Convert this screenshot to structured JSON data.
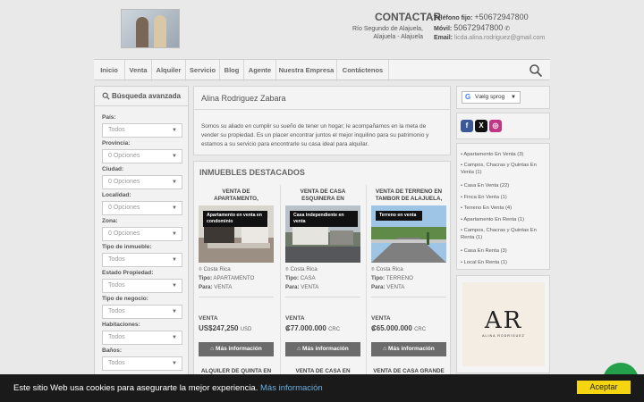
{
  "header": {
    "contact_title": "CONTACTAR",
    "address_line1": "Río Segundo de Alajuela,",
    "address_line2": "Alajuela - Alajuela",
    "phone_label": "Teléfono fijo:",
    "phone": "+50672947800",
    "mobile_label": "Móvil:",
    "mobile": "50672947800",
    "email_label": "Email:",
    "email": "licda.alina.rodriguez@gmail.com"
  },
  "nav": {
    "items": [
      "Inicio",
      "Venta",
      "Alquiler",
      "Servicio",
      "Blog",
      "Agente",
      "Nuestra Empresa",
      "Contáctenos"
    ]
  },
  "sidebar": {
    "title": "Búsqueda avanzada",
    "filters": [
      {
        "label": "País:",
        "value": "Todos"
      },
      {
        "label": "Provincia:",
        "value": "0 Opciones"
      },
      {
        "label": "Ciudad:",
        "value": "0 Opciones"
      },
      {
        "label": "Localidad:",
        "value": "0 Opciones"
      },
      {
        "label": "Zona:",
        "value": "0 Opciones"
      },
      {
        "label": "Tipo de inmueble:",
        "value": "Todos"
      },
      {
        "label": "Estado Propiedad:",
        "value": "Todos"
      },
      {
        "label": "Tipo de negocio:",
        "value": "Todos"
      },
      {
        "label": "Habitaciones:",
        "value": "Todos"
      },
      {
        "label": "Baños:",
        "value": "Todos"
      }
    ]
  },
  "intro": {
    "title": "Alina Rodriguez Zabara",
    "text": "Somos su aliado en cumplir su sueño de tener un hogar; le acompañamos en la meta de vender su propiedad. Es un placer encontrar juntos el mejor inquilino para su patrimonio y estamos a su servicio para encontrarle su casa ideal para alquilar."
  },
  "featured": {
    "title": "INMUEBLES DESTACADOS",
    "more_label": "Más información",
    "type_label": "Tipo:",
    "for_label": "Para:",
    "cards": [
      {
        "title1": "VENTA DE",
        "title2": "APARTAMENTO,",
        "tag": "Apartamento en venta en condominio",
        "location": "Costa Rica",
        "type": "APARTAMENTO",
        "for": "VENTA",
        "sale": "VENTA",
        "price": "US$247,250",
        "currency": "USD",
        "next": "ALQUILER DE QUINTA EN"
      },
      {
        "title1": "VENTA DE CASA",
        "title2": "ESQUINERA EN",
        "tag": "Casa independiente en venta",
        "location": "Costa Rica",
        "type": "CASA",
        "for": "VENTA",
        "sale": "VENTA",
        "price": "₡77.000.000",
        "currency": "CRC",
        "next": "VENTA DE CASA EN"
      },
      {
        "title1": "VENTA DE TERRENO EN",
        "title2": "TAMBOR DE ALAJUELA,",
        "tag": "Terreno en venta",
        "location": "Costa Rica",
        "type": "TERRENO",
        "for": "VENTA",
        "sale": "VENTA",
        "price": "₡65.000.000",
        "currency": "CRC",
        "next": "VENTA DE CASA GRANDE"
      }
    ]
  },
  "translate": {
    "label": "Vælg sprog",
    "arrow": "▼"
  },
  "categories": [
    "Apartamento En Venta (3)",
    "Campos, Chacras y Quintas En Venta (1)",
    "Casa En Venta (22)",
    "Finca En Venta (1)",
    "Terreno En Venta (4)",
    "Apartamento En Renta (1)",
    "Campos, Chacras y Quintas En Renta (1)",
    "Casa En Renta (3)",
    "Local En Renta (1)"
  ],
  "logo": {
    "letters": "AR",
    "subtitle": "ALINA RODRIGUEZ"
  },
  "cookie": {
    "message": "Este sitio Web usa cookies para asegurarte la mejor experiencia.",
    "link": "Más información",
    "accept": "Aceptar"
  },
  "colors": {
    "accept": "#f5d50f",
    "cookie_bg": "#1a1a1a",
    "button": "#6b6b6b",
    "chat": "#25a04a"
  }
}
